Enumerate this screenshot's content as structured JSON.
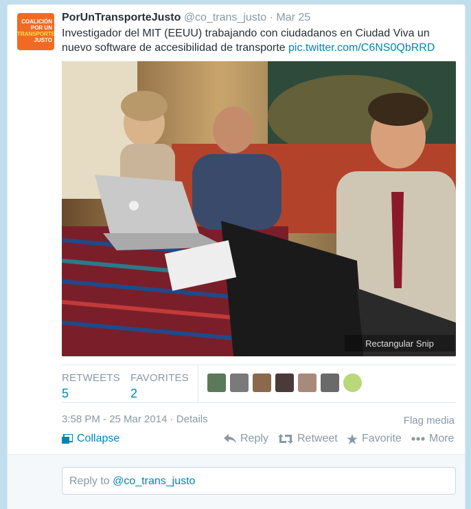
{
  "tweet": {
    "avatar_lines": [
      "COALICIÓN",
      "POR UN",
      "TRANSPORTE",
      "JUSTO"
    ],
    "name": "PorUnTransporteJusto",
    "handle": "@co_trans_justo",
    "date": "Mar 25",
    "text": "Investigador del MIT (EEUU) trabajando con ciudadanos en Ciudad Viva un nuevo software de accesibilidad de transporte ",
    "link": "pic.twitter.com/C6NS0QbRRD",
    "photo_watermark": "Rectangular Snip"
  },
  "stats": {
    "retweets_label": "RETWEETS",
    "retweets_count": "5",
    "favorites_label": "FAVORITES",
    "favorites_count": "2"
  },
  "meta": {
    "timestamp": "3:58 PM - 25 Mar 2014",
    "separator": " · ",
    "details": "Details",
    "flag": "Flag media"
  },
  "actions": {
    "collapse": "Collapse",
    "reply": "Reply",
    "retweet": "Retweet",
    "favorite": "Favorite",
    "more": "More"
  },
  "reply_box": {
    "prefix": "Reply to ",
    "handle": "@co_trans_justo"
  },
  "colors": {
    "link": "#0084b4",
    "muted": "#8899a6",
    "avatar": "#f26a21",
    "background": "#c0deed"
  }
}
